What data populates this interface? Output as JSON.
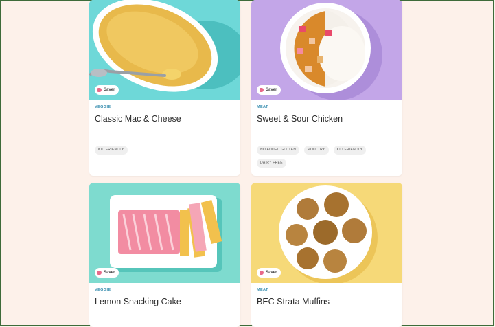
{
  "cards": [
    {
      "category": "VEGGIE",
      "title": "Classic Mac & Cheese",
      "badge": "Saver",
      "chips": [
        "KID FRIENDLY"
      ],
      "image": "mac-and-cheese-photo"
    },
    {
      "category": "MEAT",
      "title": "Sweet & Sour Chicken",
      "badge": "Saver",
      "chips": [
        "NO ADDED GLUTEN",
        "POULTRY",
        "KID FRIENDLY",
        "DAIRY FREE"
      ],
      "image": "sweet-sour-chicken-photo"
    },
    {
      "category": "VEGGIE",
      "title": "Lemon Snacking Cake",
      "badge": "Saver",
      "chips": [],
      "image": "lemon-cake-photo"
    },
    {
      "category": "MEAT",
      "title": "BEC Strata Muffins",
      "badge": "Saver",
      "chips": [],
      "image": "strata-muffins-photo"
    }
  ],
  "icons": {
    "badge": "tag-icon"
  }
}
